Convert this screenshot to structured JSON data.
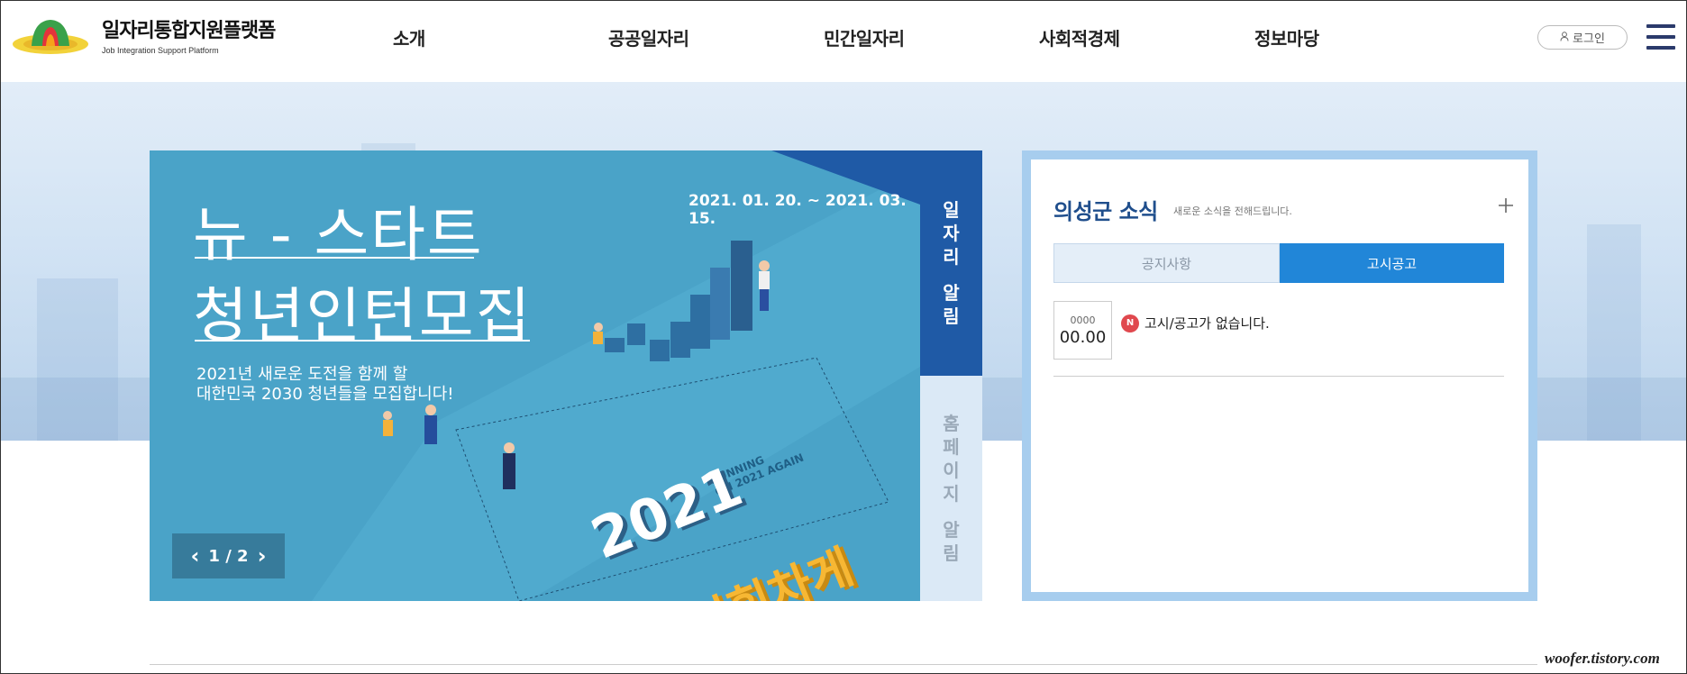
{
  "header": {
    "logo_title": "일자리통합지원플랫폼",
    "logo_subtitle": "Job Integration Support Platform",
    "nav": [
      "소개",
      "공공일자리",
      "민간일자리",
      "사회적경제",
      "정보마당"
    ],
    "login_label": "로그인",
    "menu_icon": "hamburger-icon"
  },
  "banner": {
    "title_line1": "뉴 - 스타트",
    "title_line2": "청년인턴모집",
    "date_range": "2021. 01. 20. ~ 2021. 03. 15.",
    "desc_line1": "2021년 새로운 도전을 함께 할",
    "desc_line2": "대한민국 2030 청년들을 모집합니다!",
    "big_year": "2021",
    "big_slogan": "다시힘차게",
    "small_slogan_1": "RUNNING",
    "small_slogan_2": "ON 2021 AGAIN",
    "pager_text": "1 / 2",
    "prev_icon": "chevron-left-icon",
    "next_icon": "chevron-right-icon"
  },
  "side_tabs": {
    "active": [
      "일",
      "자",
      "리",
      "알",
      "림"
    ],
    "inactive": [
      "홈",
      "페",
      "이",
      "지",
      "알",
      "림"
    ]
  },
  "news": {
    "title": "의성군 소식",
    "subtitle": "새로운 소식을 전해드립니다.",
    "more_icon": "plus-icon",
    "tabs": [
      "공지사항",
      "고시공고"
    ],
    "active_tab": "고시공고",
    "date_year": "0000",
    "date_day": "00.00",
    "badge": "N",
    "empty_message": "고시/공고가 없습니다."
  },
  "watermark": "woofer.tistory.com",
  "colors": {
    "brand_navy": "#1f4e8c",
    "tab_active": "#2186d8",
    "side_tab_active": "#1f5aa6",
    "banner_bg": "#4aa3c8",
    "panel_border": "#a7cdee",
    "badge_red": "#e0484e"
  }
}
